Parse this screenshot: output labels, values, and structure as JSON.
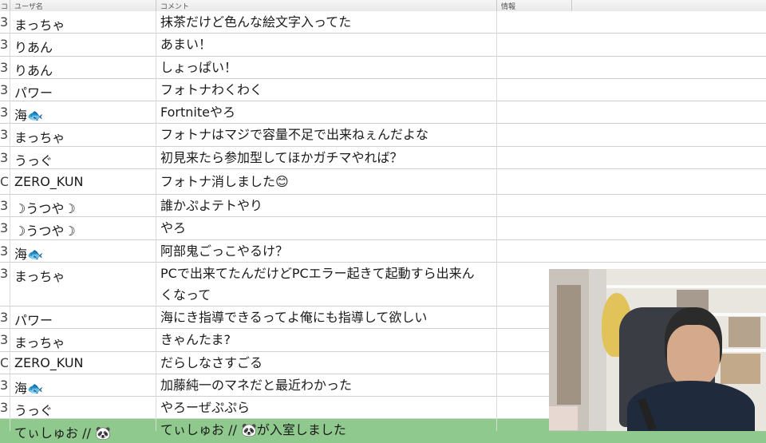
{
  "header": {
    "col_num": "コ",
    "col_user": "ユーザ名",
    "col_comment": "コメント",
    "col_info": "情報"
  },
  "rows": [
    {
      "num": "3",
      "user": "まっちゃ",
      "comment": "抹茶だけど色んな絵文字入ってた"
    },
    {
      "num": "3",
      "user": "りあん",
      "comment": "あまい！"
    },
    {
      "num": "3",
      "user": "りあん",
      "comment": "しょっぱい！"
    },
    {
      "num": "3",
      "user": "パワー",
      "comment": "フォトナわくわく"
    },
    {
      "num": "3",
      "user": "海🐟",
      "comment": "Fortniteやろ"
    },
    {
      "num": "3",
      "user": "まっちゃ",
      "comment": "フォトナはマジで容量不足で出来ねぇんだよな"
    },
    {
      "num": "3",
      "user": "うっぐ",
      "comment": "初見来たら参加型してほかガチマやれば？"
    },
    {
      "num": "C",
      "user": "ZERO_KUN",
      "comment": "フォトナ消しました😊"
    },
    {
      "num": "3",
      "user": "☽うつや☽",
      "comment": "誰かぷよテトやり"
    },
    {
      "num": "3",
      "user": "☽うつや☽",
      "comment": "やろ"
    },
    {
      "num": "3",
      "user": "海🐟",
      "comment": "阿部鬼ごっこやるけ？"
    },
    {
      "num": "3",
      "user": "まっちゃ",
      "comment": "PCで出来てたんだけどPCエラー起きて起動すら出来んくなって"
    },
    {
      "num": "3",
      "user": "パワー",
      "comment": "海にき指導できるってよ俺にも指導して欲しい"
    },
    {
      "num": "3",
      "user": "まっちゃ",
      "comment": "きゃんたま?"
    },
    {
      "num": "C",
      "user": "ZERO_KUN",
      "comment": "だらしなさすごる"
    },
    {
      "num": "3",
      "user": "海🐟",
      "comment": "加藤純一のマネだと最近わかった"
    },
    {
      "num": "3",
      "user": "うっぐ",
      "comment": "やろーぜぷぷら"
    },
    {
      "num": "",
      "user": "てぃしゅお // 🐼",
      "comment": "てぃしゅお // 🐼が入室しました"
    }
  ],
  "webcam": {
    "label": "webcam-feed"
  }
}
